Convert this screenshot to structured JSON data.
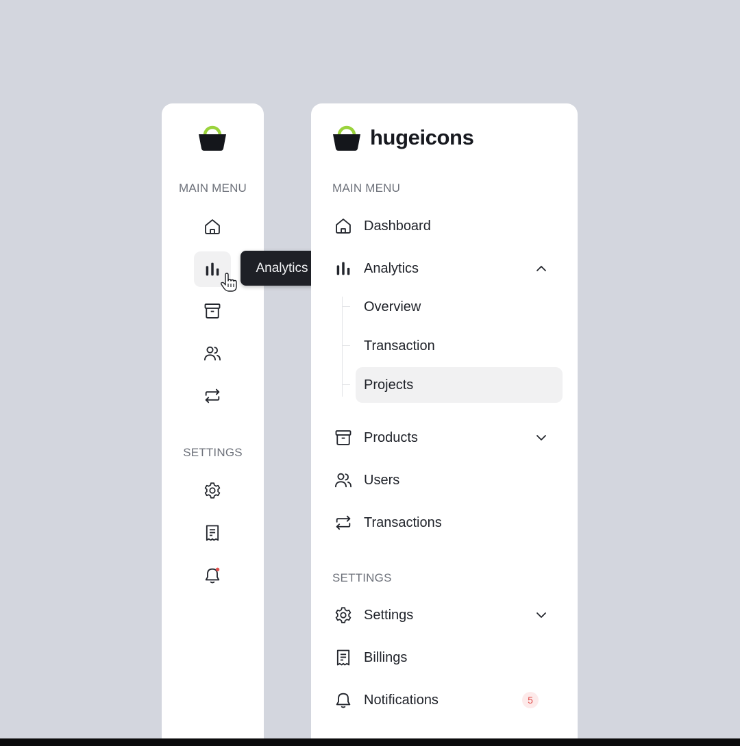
{
  "brand": {
    "name": "hugeicons",
    "accent": "#9ad33c",
    "basket_color": "#14161b"
  },
  "tooltip": {
    "text": "Analytics"
  },
  "collapsed_sidebar": {
    "main_menu_label": "MAIN MENU",
    "settings_label": "SETTINGS",
    "main_icons": [
      "home-icon",
      "analytics-icon",
      "archive-icon",
      "users-icon",
      "transactions-icon"
    ],
    "settings_icons": [
      "gear-icon",
      "billing-icon",
      "bell-icon"
    ],
    "active_icon": "analytics-icon"
  },
  "expanded_sidebar": {
    "main_menu_label": "MAIN MENU",
    "settings_label": "SETTINGS",
    "items": {
      "dashboard": "Dashboard",
      "analytics": "Analytics",
      "products": "Products",
      "users": "Users",
      "transactions": "Transactions",
      "settings": "Settings",
      "billings": "Billings",
      "notifications": "Notifications"
    },
    "analytics_sub": {
      "overview": "Overview",
      "transaction": "Transaction",
      "projects": "Projects"
    },
    "selected_sub_item": "Projects",
    "notifications_badge": "5",
    "badge_color": "#e0524f"
  }
}
